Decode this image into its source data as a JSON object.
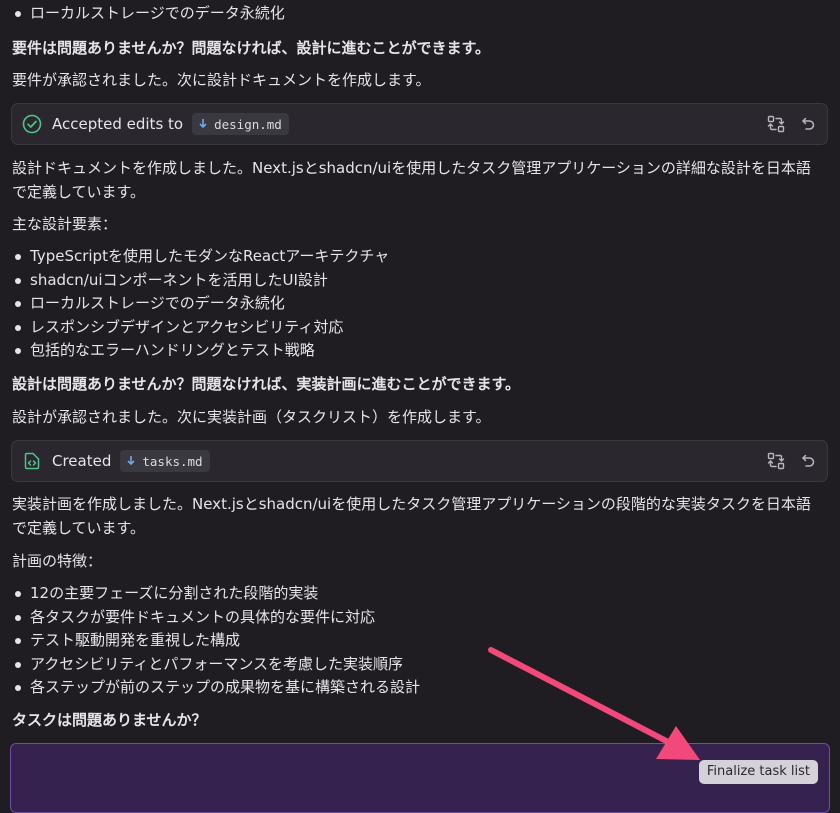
{
  "messages": {
    "top_bullet": "ローカルストレージでのデータ永続化",
    "req_question": "要件は問題ありませんか？問題なければ、設計に進むことができます。",
    "req_approved": "要件が承認されました。次に設計ドキュメントを作成します。",
    "design_card": {
      "label": "Accepted edits to",
      "file": "design.md"
    },
    "design_summary": "設計ドキュメントを作成しました。Next.jsとshadcn/uiを使用したタスク管理アプリケーションの詳細な設計を日本語で定義しています。",
    "design_elements_heading": "主な設計要素：",
    "design_bullets": [
      "TypeScriptを使用したモダンなReactアーキテクチャ",
      "shadcn/uiコンポーネントを活用したUI設計",
      "ローカルストレージでのデータ永続化",
      "レスポンシブデザインとアクセシビリティ対応",
      "包括的なエラーハンドリングとテスト戦略"
    ],
    "design_question": "設計は問題ありませんか？問題なければ、実装計画に進むことができます。",
    "design_approved": "設計が承認されました。次に実装計画（タスクリスト）を作成します。",
    "tasks_card": {
      "label": "Created",
      "file": "tasks.md"
    },
    "tasks_summary": "実装計画を作成しました。Next.jsとshadcn/uiを使用したタスク管理アプリケーションの段階的な実装タスクを日本語で定義しています。",
    "tasks_features_heading": "計画の特徴：",
    "tasks_bullets": [
      "12の主要フェーズに分割された段階的実装",
      "各タスクが要件ドキュメントの具体的な要件に対応",
      "テスト駆動開発を重視した構成",
      "アクセシビリティとパフォーマンスを考慮した実装順序",
      "各ステップが前のステップの成果物を基に構築される設計"
    ],
    "tasks_question": "タスクは問題ありませんか？"
  },
  "input": {
    "finalize_label": "Finalize task list"
  },
  "colors": {
    "accent_green": "#4fc38a",
    "arrow": "#f2487a",
    "input_bg": "#35224f",
    "input_border": "#6b4fa8"
  }
}
